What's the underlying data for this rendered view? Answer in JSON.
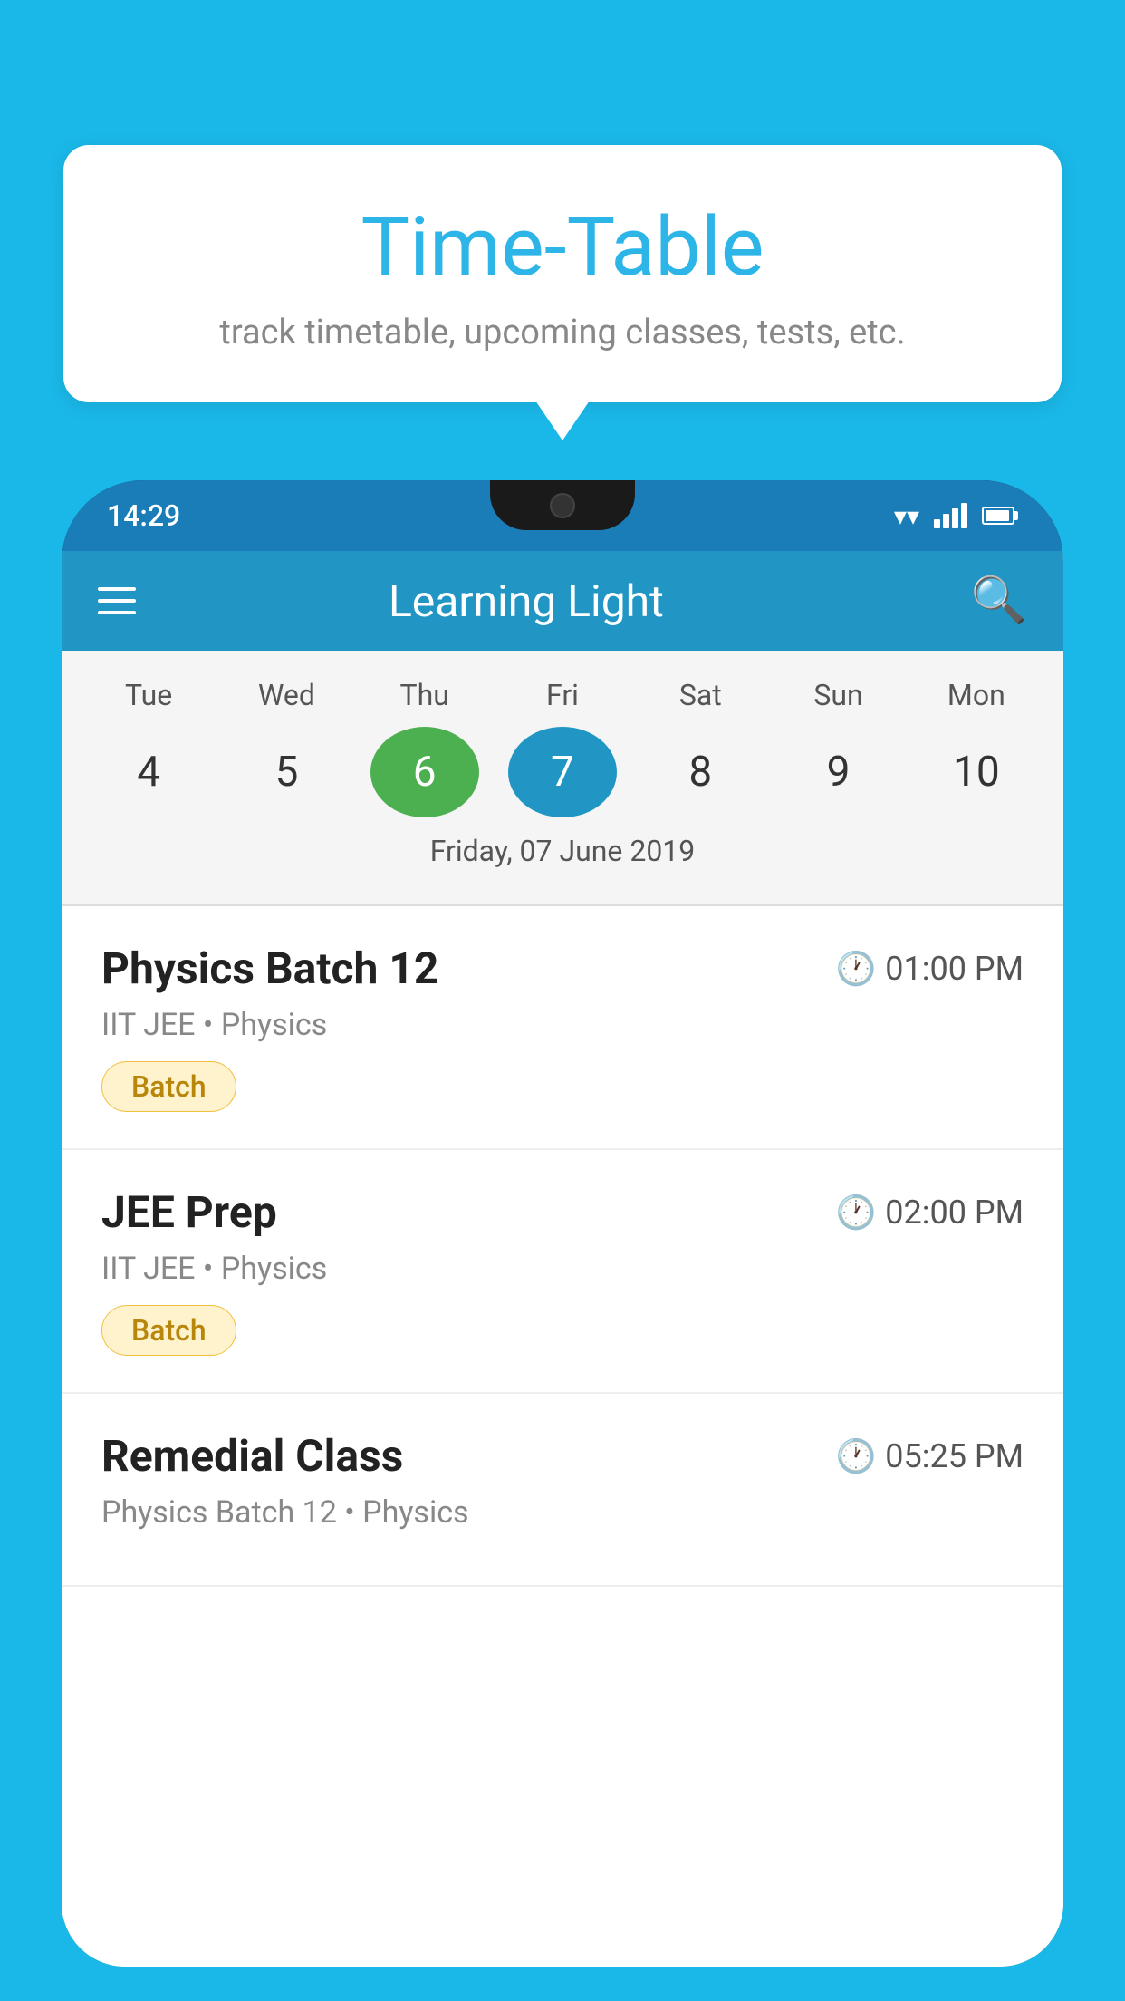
{
  "background_color": "#1ab8e8",
  "tooltip": {
    "title": "Time-Table",
    "subtitle": "track timetable, upcoming classes, tests, etc."
  },
  "phone": {
    "status_bar": {
      "time": "14:29"
    },
    "toolbar": {
      "app_name": "Learning Light"
    },
    "calendar": {
      "days": [
        {
          "name": "Tue",
          "number": "4",
          "state": "normal"
        },
        {
          "name": "Wed",
          "number": "5",
          "state": "normal"
        },
        {
          "name": "Thu",
          "number": "6",
          "state": "today"
        },
        {
          "name": "Fri",
          "number": "7",
          "state": "selected"
        },
        {
          "name": "Sat",
          "number": "8",
          "state": "normal"
        },
        {
          "name": "Sun",
          "number": "9",
          "state": "normal"
        },
        {
          "name": "Mon",
          "number": "10",
          "state": "normal"
        }
      ],
      "selected_date_label": "Friday, 07 June 2019"
    },
    "schedule": [
      {
        "title": "Physics Batch 12",
        "time": "01:00 PM",
        "subtitle": "IIT JEE • Physics",
        "badge": "Batch"
      },
      {
        "title": "JEE Prep",
        "time": "02:00 PM",
        "subtitle": "IIT JEE • Physics",
        "badge": "Batch"
      },
      {
        "title": "Remedial Class",
        "time": "05:25 PM",
        "subtitle": "Physics Batch 12 • Physics",
        "badge": null
      }
    ]
  }
}
